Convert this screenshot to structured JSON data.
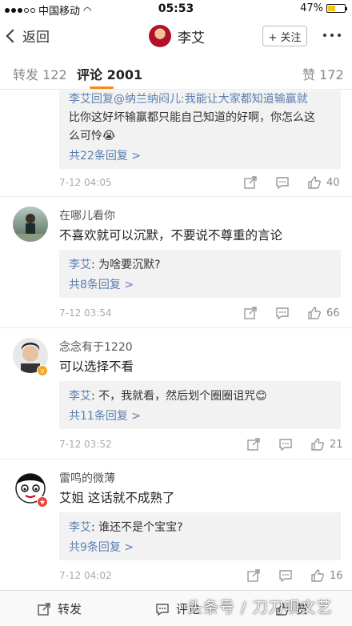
{
  "status_bar": {
    "carrier": "中国移动",
    "time": "05:53",
    "battery": "47%",
    "battery_level": 0.47
  },
  "nav": {
    "back_label": "返回",
    "title": "李艾",
    "follow_label": "+ 关注"
  },
  "tabs": {
    "repost": "转发 122",
    "comment": "评论 2001",
    "like": "赞 172"
  },
  "comments": [
    {
      "reply_lines": [
        "李艾回复@纳兰纳闷儿:我能让大家都知道输赢就",
        "比你这好坏输赢都只能自己知道的好啊，你怎么这",
        "么可怜😭"
      ],
      "more_replies": "共22条回复 >",
      "date": "7-12 04:05",
      "likes": "40"
    },
    {
      "name": "在哪儿看你",
      "text": "不喜欢就可以沉默，不要说不尊重的言论",
      "reply_author": "李艾",
      "reply_text": ": 为啥要沉默?",
      "more_replies": "共8条回复 >",
      "date": "7-12 03:54",
      "likes": "66"
    },
    {
      "name": "念念有于1220",
      "text": "可以选择不看",
      "reply_author": "李艾",
      "reply_text": ": 不，我就看，然后划个圈圈诅咒😊",
      "more_replies": "共11条回复 >",
      "date": "7-12 03:52",
      "likes": "21"
    },
    {
      "name": "雷鸣的微薄",
      "text": "艾姐 这话就不成熟了",
      "reply_author": "李艾",
      "reply_text": ": 谁还不是个宝宝?",
      "more_replies": "共9条回复 >",
      "date": "7-12 04:02",
      "likes": "16"
    }
  ],
  "bottom_bar": {
    "repost": "转发",
    "comment": "评论",
    "like": "赞"
  },
  "watermark": "头条号 / 刀刀呗文艺",
  "colors": {
    "accent": "#f28a14",
    "link": "#5b7fb0",
    "reply_bg": "#f2f2f2"
  }
}
